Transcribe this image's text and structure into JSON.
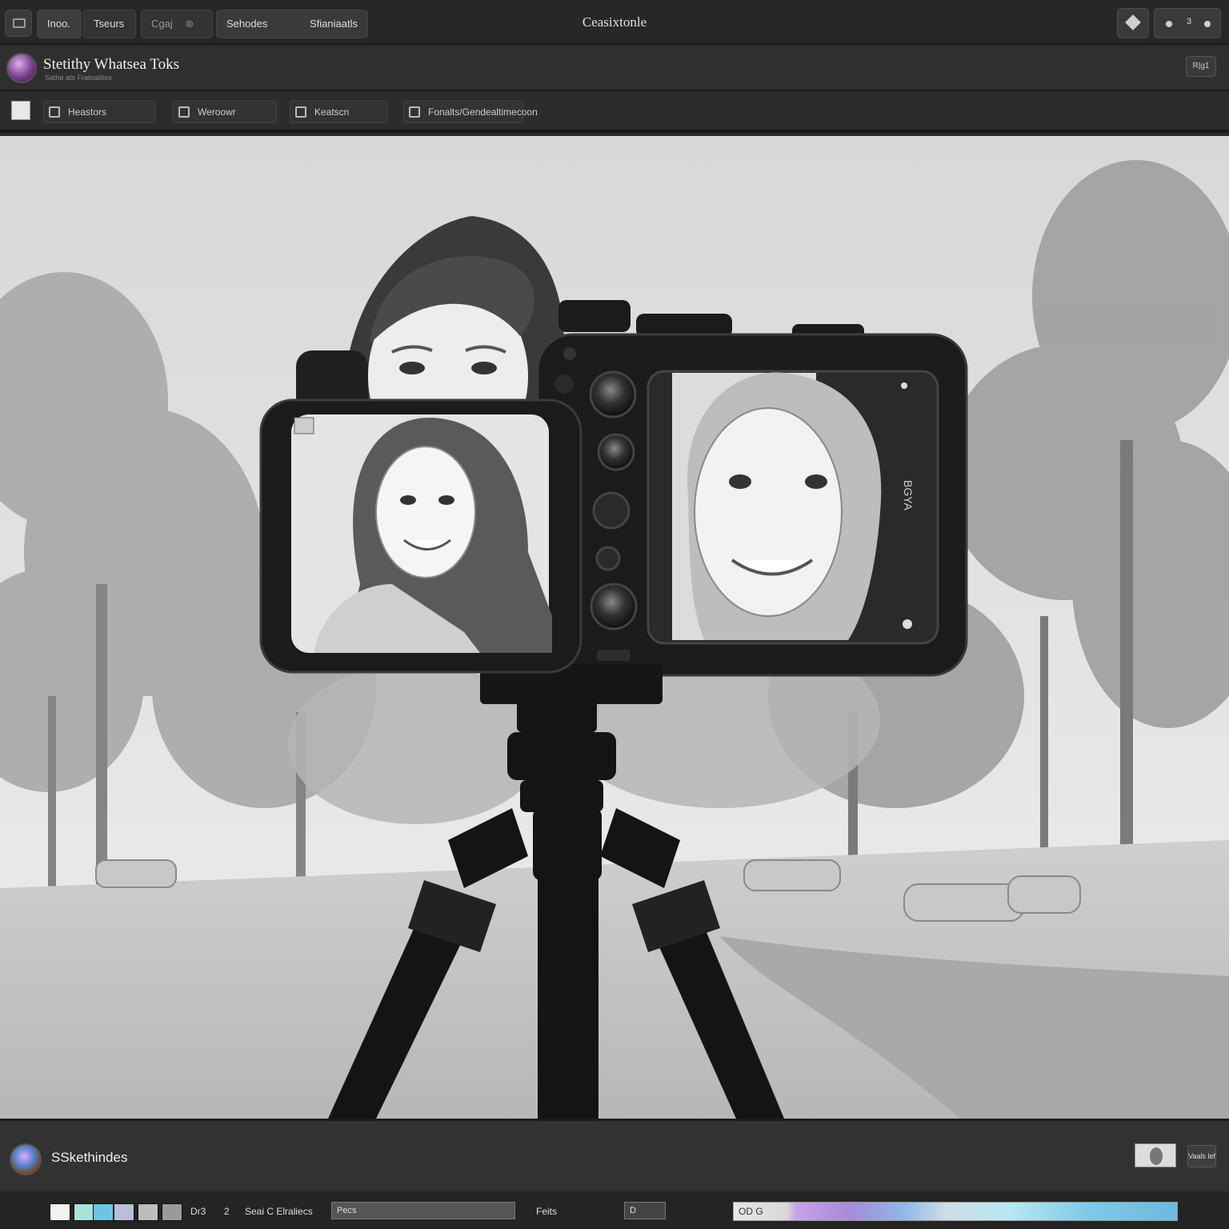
{
  "topbar": {
    "tabs": [
      "Inoo.",
      "Tseurs",
      "Cgaj"
    ],
    "wide_tab": {
      "left": "Sehodes",
      "right": "Sfianiaatls"
    },
    "title": "Ceasixtonle",
    "badge": "3"
  },
  "profile": {
    "app_name": "Stetithy Whatsea Toks",
    "app_sub": "Sathe ats Fraloatilies",
    "corner_button": "R|g1"
  },
  "toolbar": {
    "fields": [
      "Heastors",
      "Weroowr",
      "Keatscn",
      "Fonalts/Gendealtimecoon"
    ]
  },
  "bottom": {
    "label": "SSkethindes",
    "button": "Vaals lef"
  },
  "status": {
    "swatch_colors": [
      "#f2f2f2",
      "#a9e3d8",
      "#6fc3e8",
      "#b8bfd6",
      "#bdbdbd",
      "#9a9a9a"
    ],
    "items": [
      "Dr3",
      "2",
      "Seai C Elraliecs",
      "Pe/s",
      "Feits",
      "D"
    ],
    "slider1": "Pecs",
    "slider2": "OD G"
  },
  "canvas": {
    "screen_label": "BGYA",
    "panel_bg": "#e6e6e6",
    "camera_color": "#1b1b1b"
  }
}
